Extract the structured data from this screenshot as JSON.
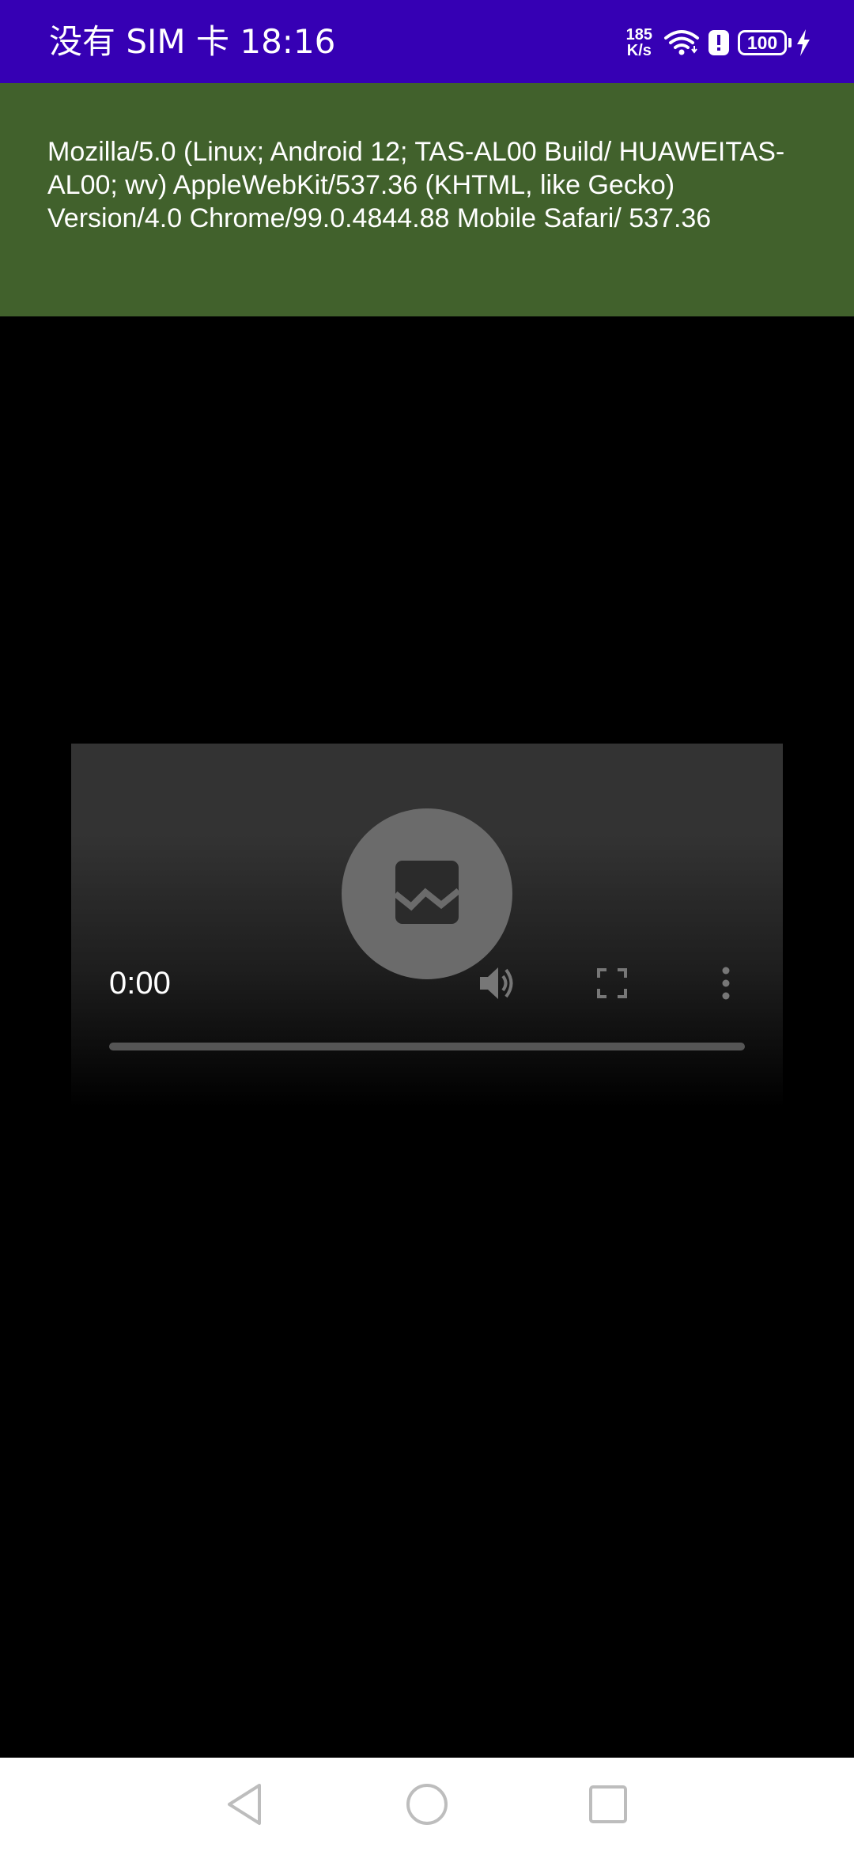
{
  "status_bar": {
    "carrier": "没有 SIM 卡",
    "time": "18:16",
    "net_speed_value": "185",
    "net_speed_unit": "K/s",
    "battery_level": "100",
    "icons": [
      "wifi-icon",
      "alert-icon",
      "battery-icon",
      "charging-icon"
    ],
    "background_color": "#3600b4"
  },
  "banner": {
    "user_agent": "Mozilla/5.0 (Linux; Android 12; TAS-AL00 Build/ HUAWEITAS-AL00; wv) AppleWebKit/537.36 (KHTML, like Gecko) Version/4.0 Chrome/99.0.4844.88 Mobile Safari/ 537.36",
    "background_color": "#41612c"
  },
  "video_player": {
    "current_time": "0:00",
    "progress": 0,
    "center_icon": "broken-image-icon",
    "controls": [
      "volume-icon",
      "fullscreen-icon",
      "more-options-icon"
    ]
  },
  "nav_bar": {
    "buttons": [
      "back-triangle-icon",
      "home-circle-icon",
      "recents-square-icon"
    ]
  }
}
